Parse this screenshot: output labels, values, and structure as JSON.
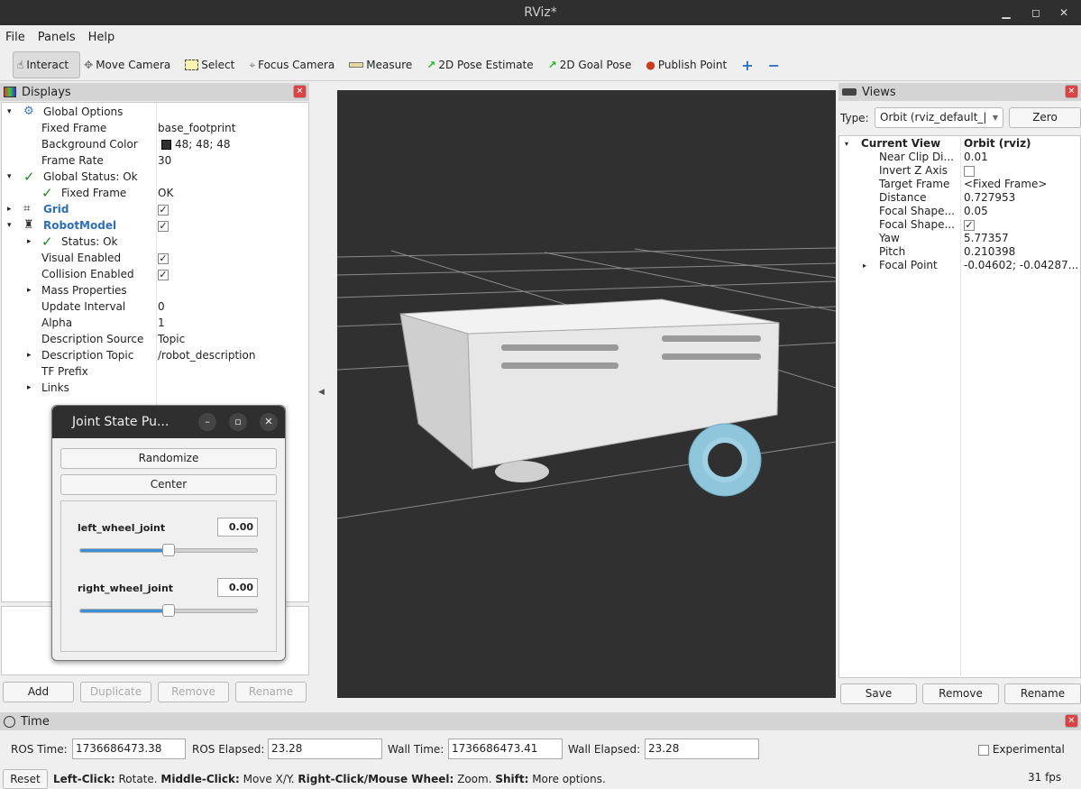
{
  "window": {
    "title": "RViz*"
  },
  "menu": [
    "File",
    "Panels",
    "Help"
  ],
  "toolbar": {
    "tools": [
      "Interact",
      "Move Camera",
      "Select",
      "Focus Camera",
      "Measure",
      "2D Pose Estimate",
      "2D Goal Pose",
      "Publish Point"
    ],
    "active": "Interact"
  },
  "displays": {
    "title": "Displays",
    "rows": [
      {
        "label": "Global Options",
        "value": ""
      },
      {
        "label": "Fixed Frame",
        "value": "base_footprint"
      },
      {
        "label": "Background Color",
        "value": "48; 48; 48"
      },
      {
        "label": "Frame Rate",
        "value": "30"
      },
      {
        "label": "Global Status: Ok",
        "value": ""
      },
      {
        "label": "Fixed Frame",
        "value": "OK"
      },
      {
        "label": "Grid",
        "value": ""
      },
      {
        "label": "RobotModel",
        "value": ""
      },
      {
        "label": "Status: Ok",
        "value": ""
      },
      {
        "label": "Visual Enabled",
        "value": ""
      },
      {
        "label": "Collision Enabled",
        "value": ""
      },
      {
        "label": "Mass Properties",
        "value": ""
      },
      {
        "label": "Update Interval",
        "value": "0"
      },
      {
        "label": "Alpha",
        "value": "1"
      },
      {
        "label": "Description Source",
        "value": "Topic"
      },
      {
        "label": "Description Topic",
        "value": "/robot_description"
      },
      {
        "label": "TF Prefix",
        "value": ""
      },
      {
        "label": "Links",
        "value": ""
      }
    ],
    "buttons": {
      "add": "Add",
      "duplicate": "Duplicate",
      "remove": "Remove",
      "rename": "Rename"
    },
    "bg_color": "#303030"
  },
  "joint_state": {
    "title": "Joint State Pu...",
    "randomize": "Randomize",
    "center": "Center",
    "joints": [
      {
        "name": "left_wheel_joint",
        "value": "0.00",
        "fraction": 0.5
      },
      {
        "name": "right_wheel_joint",
        "value": "0.00",
        "fraction": 0.5
      }
    ]
  },
  "views": {
    "title": "Views",
    "type_label": "Type:",
    "type_value": "Orbit (rviz_default_|",
    "zero": "Zero",
    "rows": [
      {
        "label": "Current View",
        "value": "Orbit (rviz)"
      },
      {
        "label": "Near Clip Di...",
        "value": "0.01"
      },
      {
        "label": "Invert Z Axis",
        "value": ""
      },
      {
        "label": "Target Frame",
        "value": "<Fixed Frame>"
      },
      {
        "label": "Distance",
        "value": "0.727953"
      },
      {
        "label": "Focal Shape...",
        "value": "0.05"
      },
      {
        "label": "Focal Shape...",
        "value": ""
      },
      {
        "label": "Yaw",
        "value": "5.77357"
      },
      {
        "label": "Pitch",
        "value": "0.210398"
      },
      {
        "label": "Focal Point",
        "value": "-0.04602; -0.04287..."
      }
    ],
    "buttons": {
      "save": "Save",
      "remove": "Remove",
      "rename": "Rename"
    }
  },
  "time": {
    "title": "Time",
    "ros_time_label": "ROS Time:",
    "ros_time": "1736686473.38",
    "ros_elapsed_label": "ROS Elapsed:",
    "ros_elapsed": "23.28",
    "wall_time_label": "Wall Time:",
    "wall_time": "1736686473.41",
    "wall_elapsed_label": "Wall Elapsed:",
    "wall_elapsed": "23.28",
    "experimental": "Experimental"
  },
  "status": {
    "reset": "Reset",
    "hint": [
      [
        "Left-Click:",
        " Rotate. "
      ],
      [
        "Middle-Click:",
        " Move X/Y. "
      ],
      [
        "Right-Click/Mouse Wheel:",
        " Zoom. "
      ],
      [
        "Shift:",
        " More options."
      ]
    ],
    "fps": "31 fps"
  }
}
